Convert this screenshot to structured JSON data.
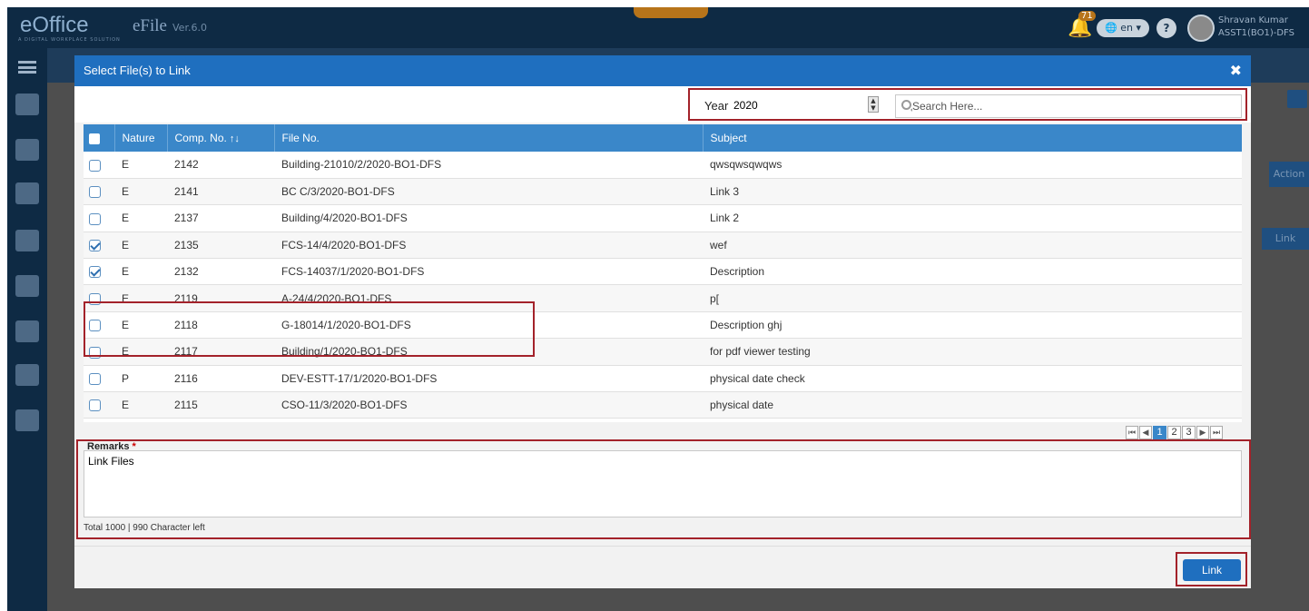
{
  "app": {
    "logo": "eOffice",
    "logo_tagline": "A DIGITAL WORKPLACE SOLUTION",
    "product": "eFile",
    "version": "Ver.6.0",
    "notification_count": "71",
    "language": "en",
    "help_label": "?",
    "user_name": "Shravan Kumar",
    "user_role": "ASST1(BO1)-DFS"
  },
  "background": {
    "action_header": "Action",
    "link_label": "Link"
  },
  "modal": {
    "title": "Select File(s) to Link",
    "close_label": "✖",
    "year_label": "Year",
    "year_value": "2020",
    "search_placeholder": "Search Here...",
    "columns": [
      "Nature",
      "Comp. No.",
      "File No.",
      "Subject"
    ],
    "sort_icon": "↑↓",
    "rows": [
      {
        "checked": false,
        "nature": "E",
        "comp": "2142",
        "file": "Building-21010/2/2020-BO1-DFS",
        "subject": "qwsqwsqwqws"
      },
      {
        "checked": false,
        "nature": "E",
        "comp": "2141",
        "file": "BC C/3/2020-BO1-DFS",
        "subject": "Link 3"
      },
      {
        "checked": false,
        "nature": "E",
        "comp": "2137",
        "file": "Building/4/2020-BO1-DFS",
        "subject": "Link 2"
      },
      {
        "checked": true,
        "nature": "E",
        "comp": "2135",
        "file": "FCS-14/4/2020-BO1-DFS",
        "subject": "wef"
      },
      {
        "checked": true,
        "nature": "E",
        "comp": "2132",
        "file": "FCS-14037/1/2020-BO1-DFS",
        "subject": "Description"
      },
      {
        "checked": false,
        "nature": "E",
        "comp": "2119",
        "file": "A-24/4/2020-BO1-DFS",
        "subject": "p["
      },
      {
        "checked": false,
        "nature": "E",
        "comp": "2118",
        "file": "G-18014/1/2020-BO1-DFS",
        "subject": "Description ghj"
      },
      {
        "checked": false,
        "nature": "E",
        "comp": "2117",
        "file": "Building/1/2020-BO1-DFS",
        "subject": "for pdf viewer testing"
      },
      {
        "checked": false,
        "nature": "P",
        "comp": "2116",
        "file": "DEV-ESTT-17/1/2020-BO1-DFS",
        "subject": "physical date check"
      },
      {
        "checked": false,
        "nature": "E",
        "comp": "2115",
        "file": "CSO-11/3/2020-BO1-DFS",
        "subject": "physical date"
      }
    ],
    "pagination": {
      "first": "⏮",
      "prev": "◀",
      "pages": [
        "1",
        "2",
        "3"
      ],
      "current": "1",
      "next": "▶",
      "last": "⏭"
    },
    "remarks_label": "Remarks",
    "remarks_required": "*",
    "remarks_value": "Link Files",
    "char_count": "Total 1000 | 990 Character left",
    "link_button": "Link"
  },
  "colors": {
    "header_blue": "#1f6fbf",
    "table_header": "#3a87c9",
    "highlight_border": "#a3222a"
  }
}
